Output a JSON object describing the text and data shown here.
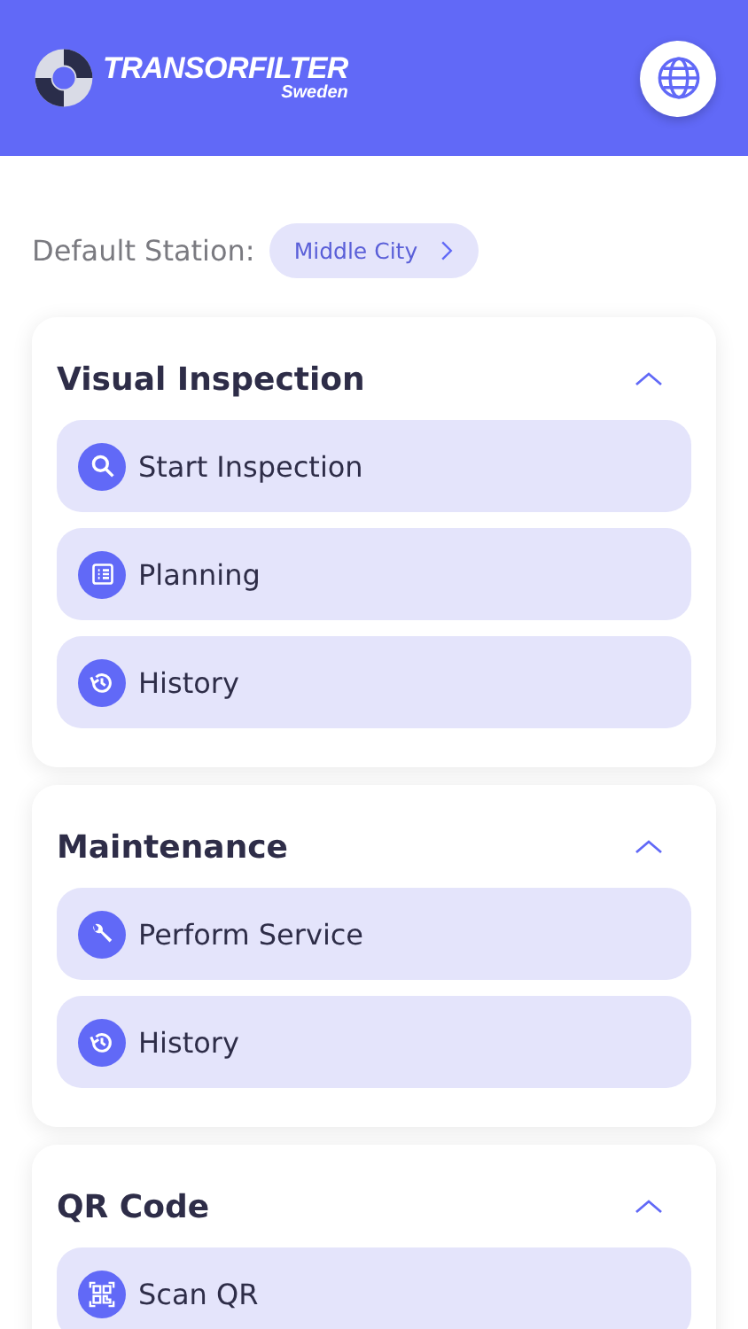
{
  "header": {
    "brand": "TRANSORFILTER",
    "region": "Sweden"
  },
  "station": {
    "label": "Default Station:",
    "value": "Middle City"
  },
  "sections": [
    {
      "title": "Visual Inspection",
      "expanded": true,
      "items": [
        {
          "label": "Start Inspection",
          "kind": "search"
        },
        {
          "label": "Planning",
          "kind": "list"
        },
        {
          "label": "History",
          "kind": "history"
        }
      ]
    },
    {
      "title": "Maintenance",
      "expanded": true,
      "items": [
        {
          "label": "Perform Service",
          "kind": "wrench"
        },
        {
          "label": "History",
          "kind": "history"
        }
      ]
    },
    {
      "title": "QR Code",
      "expanded": true,
      "items": [
        {
          "label": "Scan QR",
          "kind": "qr"
        }
      ]
    }
  ]
}
